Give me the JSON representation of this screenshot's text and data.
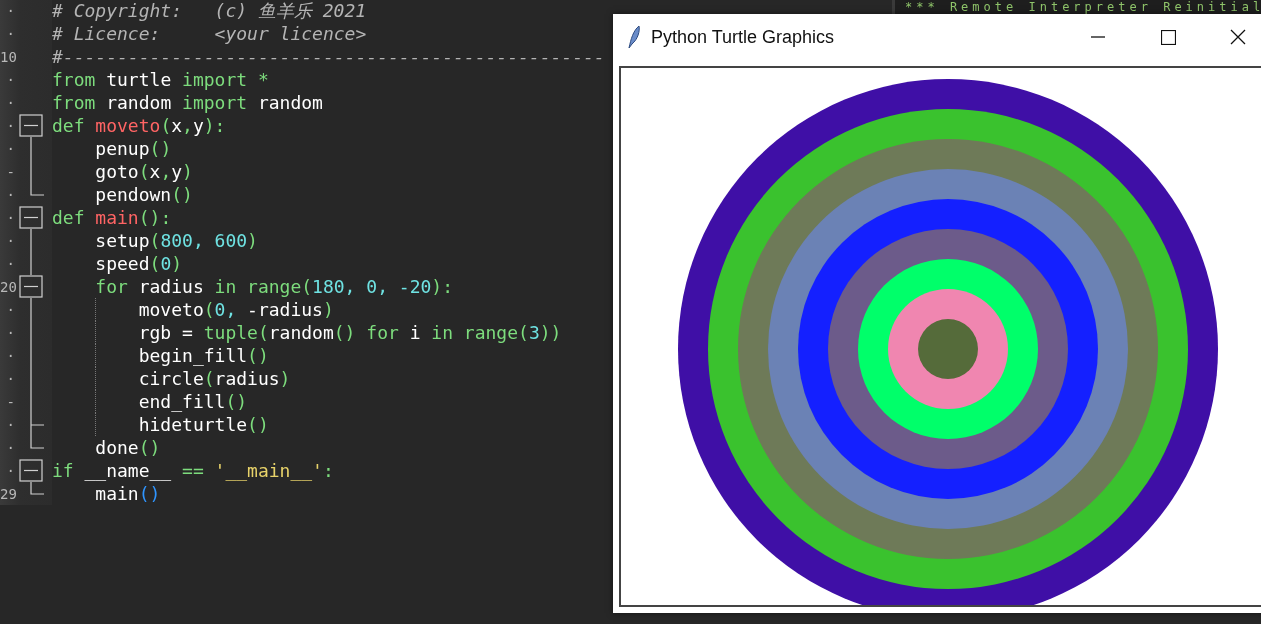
{
  "editor": {
    "lines": [
      {
        "gutter": "·",
        "tokens": [
          {
            "kind": "comment",
            "text": "# Copyright:   (c) 鱼羊乐 2021"
          }
        ]
      },
      {
        "gutter": "·",
        "tokens": [
          {
            "kind": "comment",
            "text": "# Licence:     <your licence>"
          }
        ]
      },
      {
        "gutter": "10",
        "tokens": [
          {
            "kind": "comment",
            "text": "#--------------------------------------------------"
          }
        ]
      },
      {
        "gutter": "·",
        "tokens": [
          {
            "kind": "kw",
            "text": "from"
          },
          {
            "kind": "id",
            "text": " turtle "
          },
          {
            "kind": "kw",
            "text": "import"
          },
          {
            "kind": "punct",
            "text": " *"
          }
        ]
      },
      {
        "gutter": "·",
        "tokens": [
          {
            "kind": "kw",
            "text": "from"
          },
          {
            "kind": "id",
            "text": " random "
          },
          {
            "kind": "kw",
            "text": "import"
          },
          {
            "kind": "id",
            "text": " random"
          }
        ]
      },
      {
        "gutter": "·",
        "fold": {
          "kind": "box"
        },
        "tokens": [
          {
            "kind": "kw",
            "text": "def "
          },
          {
            "kind": "fn",
            "text": "moveto"
          },
          {
            "kind": "punct",
            "text": "("
          },
          {
            "kind": "id",
            "text": "x"
          },
          {
            "kind": "punct",
            "text": ","
          },
          {
            "kind": "id",
            "text": "y"
          },
          {
            "kind": "punct",
            "text": "):"
          }
        ]
      },
      {
        "gutter": "·",
        "fold": {
          "kind": "line"
        },
        "tokens": [
          {
            "kind": "id",
            "text": "    penup"
          },
          {
            "kind": "punct",
            "text": "()"
          }
        ]
      },
      {
        "gutter": "-",
        "fold": {
          "kind": "line"
        },
        "tokens": [
          {
            "kind": "id",
            "text": "    goto"
          },
          {
            "kind": "punct",
            "text": "("
          },
          {
            "kind": "id",
            "text": "x"
          },
          {
            "kind": "punct",
            "text": ","
          },
          {
            "kind": "id",
            "text": "y"
          },
          {
            "kind": "punct",
            "text": ")"
          }
        ]
      },
      {
        "gutter": "·",
        "fold": {
          "kind": "end"
        },
        "tokens": [
          {
            "kind": "id",
            "text": "    pendown"
          },
          {
            "kind": "punct",
            "text": "()"
          }
        ]
      },
      {
        "gutter": "·",
        "fold": {
          "kind": "box"
        },
        "tokens": [
          {
            "kind": "kw",
            "text": "def "
          },
          {
            "kind": "fn",
            "text": "main"
          },
          {
            "kind": "punct",
            "text": "():"
          }
        ]
      },
      {
        "gutter": "·",
        "fold": {
          "kind": "line"
        },
        "tokens": [
          {
            "kind": "id",
            "text": "    setup"
          },
          {
            "kind": "punct",
            "text": "("
          },
          {
            "kind": "num",
            "text": "800, 600"
          },
          {
            "kind": "punct",
            "text": ")"
          }
        ]
      },
      {
        "gutter": "·",
        "fold": {
          "kind": "line"
        },
        "tokens": [
          {
            "kind": "id",
            "text": "    speed"
          },
          {
            "kind": "punct",
            "text": "("
          },
          {
            "kind": "num",
            "text": "0"
          },
          {
            "kind": "punct",
            "text": ")"
          }
        ]
      },
      {
        "gutter": "20",
        "fold": {
          "kind": "box"
        },
        "tokens": [
          {
            "kind": "kw",
            "text": "    for"
          },
          {
            "kind": "id",
            "text": " radius "
          },
          {
            "kind": "kw",
            "text": "in range"
          },
          {
            "kind": "punct",
            "text": "("
          },
          {
            "kind": "num",
            "text": "180, 0, -20"
          },
          {
            "kind": "punct",
            "text": "):"
          }
        ]
      },
      {
        "gutter": "·",
        "fold": {
          "kind": "line"
        },
        "guide": true,
        "tokens": [
          {
            "kind": "id",
            "text": "        moveto"
          },
          {
            "kind": "punct",
            "text": "("
          },
          {
            "kind": "num",
            "text": "0,"
          },
          {
            "kind": "id",
            "text": " -radius"
          },
          {
            "kind": "punct",
            "text": ")"
          }
        ]
      },
      {
        "gutter": "·",
        "fold": {
          "kind": "line"
        },
        "guide": true,
        "tokens": [
          {
            "kind": "id",
            "text": "        rgb = "
          },
          {
            "kind": "kw",
            "text": "tuple"
          },
          {
            "kind": "punct",
            "text": "("
          },
          {
            "kind": "id",
            "text": "random"
          },
          {
            "kind": "punct",
            "text": "() "
          },
          {
            "kind": "kw",
            "text": "for"
          },
          {
            "kind": "id",
            "text": " i "
          },
          {
            "kind": "kw",
            "text": "in range"
          },
          {
            "kind": "punct",
            "text": "("
          },
          {
            "kind": "num",
            "text": "3"
          },
          {
            "kind": "punct",
            "text": "))"
          }
        ]
      },
      {
        "gutter": "·",
        "fold": {
          "kind": "line"
        },
        "guide": true,
        "tokens": [
          {
            "kind": "id",
            "text": "        begin_fill"
          },
          {
            "kind": "punct",
            "text": "()"
          }
        ]
      },
      {
        "gutter": "·",
        "fold": {
          "kind": "line"
        },
        "guide": true,
        "tokens": [
          {
            "kind": "id",
            "text": "        circle"
          },
          {
            "kind": "punct",
            "text": "("
          },
          {
            "kind": "id",
            "text": "radius"
          },
          {
            "kind": "punct",
            "text": ")"
          }
        ]
      },
      {
        "gutter": "-",
        "fold": {
          "kind": "line"
        },
        "guide": true,
        "tokens": [
          {
            "kind": "id",
            "text": "        end_fill"
          },
          {
            "kind": "punct",
            "text": "()"
          }
        ]
      },
      {
        "gutter": "·",
        "fold": {
          "kind": "branch"
        },
        "guide": true,
        "tokens": [
          {
            "kind": "id",
            "text": "        hideturtle"
          },
          {
            "kind": "punct",
            "text": "()"
          }
        ]
      },
      {
        "gutter": "·",
        "fold": {
          "kind": "end"
        },
        "tokens": [
          {
            "kind": "id",
            "text": "    done"
          },
          {
            "kind": "punct",
            "text": "()"
          }
        ]
      },
      {
        "gutter": "·",
        "fold": {
          "kind": "box"
        },
        "tokens": [
          {
            "kind": "kw",
            "text": "if "
          },
          {
            "kind": "id",
            "text": "__name__"
          },
          {
            "kind": "punct",
            "text": " == "
          },
          {
            "kind": "str",
            "text": "'__main__'"
          },
          {
            "kind": "punct",
            "text": ":"
          }
        ]
      },
      {
        "gutter": "29",
        "fold": {
          "kind": "end"
        },
        "tokens": [
          {
            "kind": "id",
            "text": "    main"
          },
          {
            "kind": "match",
            "text": "()"
          }
        ]
      }
    ]
  },
  "shell": {
    "text": "*** Remote Interpreter Reinitial"
  },
  "turtle_window": {
    "title": "Python Turtle Graphics"
  }
}
